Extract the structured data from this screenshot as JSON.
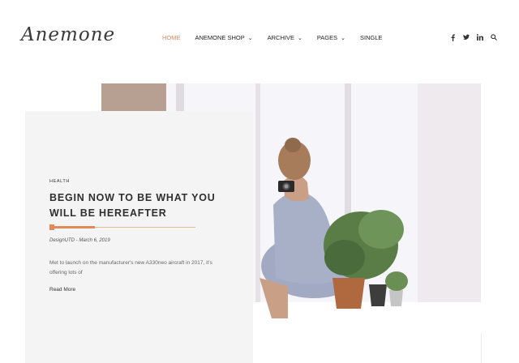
{
  "brand": {
    "logo_text": "Anemone"
  },
  "nav": {
    "items": [
      {
        "label": "HOME",
        "active": true,
        "has_dropdown": false
      },
      {
        "label": "ANEMONE SHOP",
        "active": false,
        "has_dropdown": true
      },
      {
        "label": "ARCHIVE",
        "active": false,
        "has_dropdown": true
      },
      {
        "label": "PAGES",
        "active": false,
        "has_dropdown": true
      },
      {
        "label": "SINGLE",
        "active": false,
        "has_dropdown": false
      }
    ],
    "social_icons": [
      "facebook-icon",
      "twitter-icon",
      "linkedin-icon",
      "search-icon"
    ]
  },
  "post": {
    "category": "HEALTH",
    "title": "BEGIN NOW TO BE WHAT YOU WILL BE HEREAFTER",
    "meta": "DesignUTD - March 6, 2019",
    "excerpt": "Met to launch on the manufacturer's new A330neo aircraft in 2017, it's offering lots of",
    "read_more": "Read More"
  },
  "colors": {
    "accent": "#e08a5c",
    "card_bg": "#f4f4f4",
    "text": "#2f2f2f"
  }
}
